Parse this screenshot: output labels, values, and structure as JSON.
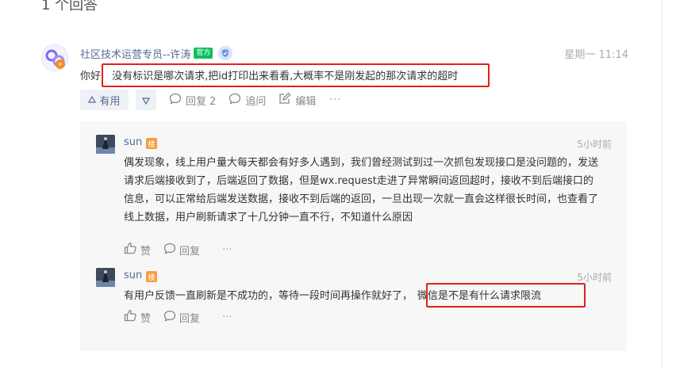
{
  "header": {
    "answers_count": "1 个回答"
  },
  "answer": {
    "author": "社区技术运营专员--许涛",
    "official_badge": "官方",
    "time": "星期一 11:14",
    "text_prefix": "你好,",
    "text_highlight": "没有标识是哪次请求,把id打印出来看看,大概率不是刚发起的那次请求的超时",
    "actions": {
      "useful_label": "有用",
      "reply_label": "回复 2",
      "ask_label": "追问",
      "edit_label": "编辑",
      "more_label": "···"
    }
  },
  "replies": [
    {
      "author": "sun",
      "badge": "楼",
      "time": "5小时前",
      "text": "偶发现象，线上用户量大每天都会有好多人遇到，我们曾经测试到过一次抓包发现接口是没问题的，发送请求后端接收到了，后端返回了数据，但是wx.request走进了异常瞬间返回超时，接收不到后端接口的信息，可以正常给后端发送数据，接收不到后端的返回，一旦出现一次就一直会这样很长时间，也查看了线上数据，用户刷新请求了十几分钟一直不行，不知道什么原因",
      "like_label": "赞",
      "reply_label": "回复",
      "more_label": "···"
    },
    {
      "author": "sun",
      "badge": "楼",
      "time": "5小时前",
      "text_prefix": "有用户反馈一直刷新是不成功的，等待一段时间再操作就好了，",
      "text_highlight": "微信是不是有什么请求限流",
      "like_label": "赞",
      "reply_label": "回复",
      "more_label": "···"
    }
  ],
  "colors": {
    "link_blue": "#576b95",
    "official_green": "#07c160",
    "badge_orange": "#fa9d3b",
    "highlight_red": "#e3201b",
    "panel_bg": "#f7f7f7"
  }
}
